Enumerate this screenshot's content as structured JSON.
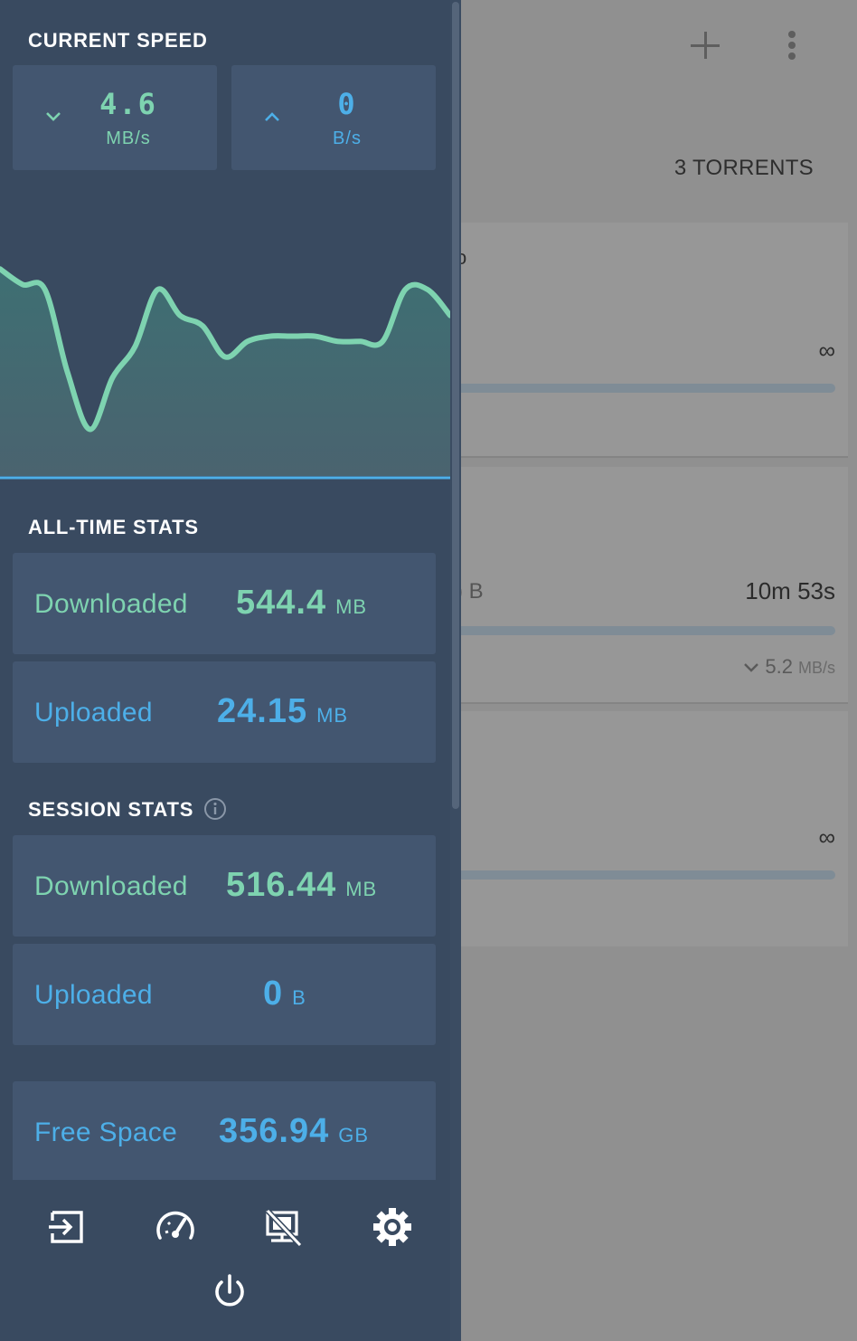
{
  "background": {
    "torrent_count": "3 TORRENTS",
    "add_icon": "plus-icon",
    "menu_icon": "more-vertical-icon",
    "cards": [
      {
        "fragment": "o",
        "ratio": "∞"
      },
      {
        "size_fragment": ") B",
        "eta": "10m 53s",
        "download_rate": "5.2",
        "download_rate_unit": "MB/s"
      },
      {
        "ratio": "∞"
      }
    ]
  },
  "drawer": {
    "current_speed": {
      "title": "CURRENT SPEED",
      "download": {
        "value": "4.6",
        "unit": "MB/s",
        "icon": "chevron-down-icon"
      },
      "upload": {
        "value": "0",
        "unit": "B/s",
        "icon": "chevron-up-icon"
      }
    },
    "all_time": {
      "title": "ALL-TIME STATS",
      "downloaded": {
        "label": "Downloaded",
        "value": "544.4",
        "unit": "MB"
      },
      "uploaded": {
        "label": "Uploaded",
        "value": "24.15",
        "unit": "MB"
      }
    },
    "session": {
      "title": "SESSION STATS",
      "info_icon": "info-icon",
      "downloaded": {
        "label": "Downloaded",
        "value": "516.44",
        "unit": "MB"
      },
      "uploaded": {
        "label": "Uploaded",
        "value": "0",
        "unit": "B"
      }
    },
    "free_space": {
      "label": "Free Space",
      "value": "356.94",
      "unit": "GB"
    },
    "actions": [
      {
        "icon": "logout-icon"
      },
      {
        "icon": "speedometer-icon"
      },
      {
        "icon": "remote-off-icon"
      },
      {
        "icon": "settings-icon"
      },
      {
        "icon": "power-icon"
      }
    ]
  },
  "colors": {
    "drawer_bg": "#394a60",
    "box_bg": "#435670",
    "download_green": "#7ed3b0",
    "upload_blue": "#4dafe8"
  },
  "chart_data": {
    "type": "area",
    "series": [
      {
        "values": [
          4.0,
          3.7,
          3.6,
          2.0,
          0.9,
          1.9,
          2.5,
          3.6,
          3.1,
          2.9,
          2.3,
          2.6,
          2.7,
          2.7,
          2.7,
          2.6,
          2.6,
          2.6,
          3.6,
          3.6,
          3.1
        ]
      }
    ],
    "xlabel": "",
    "ylabel": "",
    "ylim": [
      0,
      5
    ],
    "grid": false,
    "legend": "none"
  }
}
